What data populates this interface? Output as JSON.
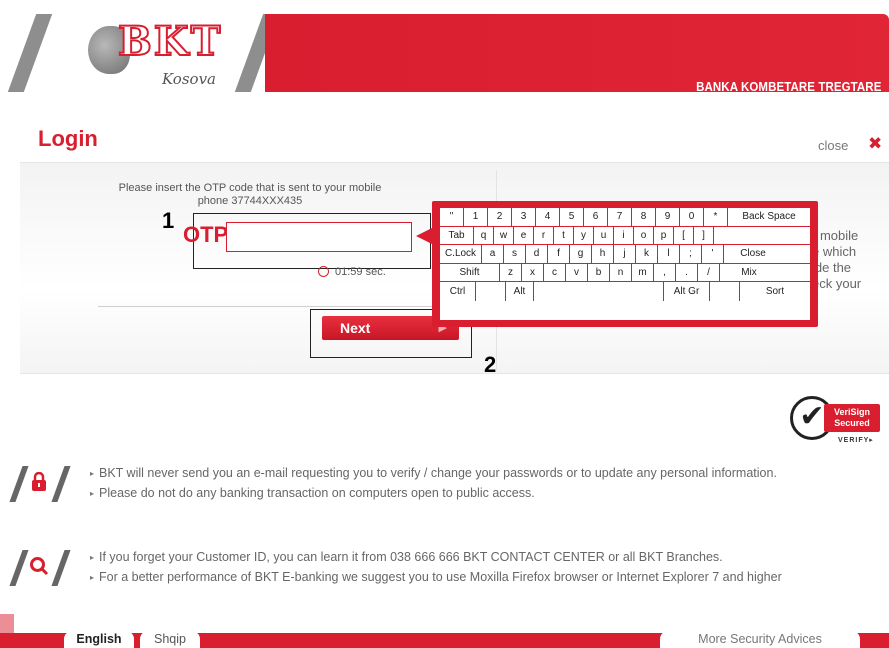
{
  "header": {
    "logo_text": "BKT",
    "logo_subtitle": "Kosova",
    "bank_name": "BANKA KOMBETARE TREGTARE"
  },
  "login": {
    "title": "Login",
    "close_label": "close",
    "close_icon": "✖",
    "instruction_line1": "Please insert the OTP code that is sent to your mobile",
    "instruction_line2": "phone 37744XXX435",
    "otp_label": "OTP",
    "otp_value": "",
    "timer_text": "01:59 sec.",
    "next_label": "Next",
    "next_arrow": "▶",
    "annotation_1": "1",
    "annotation_2": "2",
    "side_text": [
      "r mobile",
      "e which",
      "ide the",
      "eck your"
    ]
  },
  "keyboard": {
    "rows": [
      [
        "\"",
        "1",
        "2",
        "3",
        "4",
        "5",
        "6",
        "7",
        "8",
        "9",
        "0",
        "*",
        "Back Space"
      ],
      [
        "Tab",
        "q",
        "w",
        "e",
        "r",
        "t",
        "y",
        "u",
        "i",
        "o",
        "p",
        "[",
        "]",
        ""
      ],
      [
        "C.Lock",
        "a",
        "s",
        "d",
        "f",
        "g",
        "h",
        "j",
        "k",
        "l",
        ";",
        "'",
        "Close"
      ],
      [
        "Shift",
        "z",
        "x",
        "c",
        "v",
        "b",
        "n",
        "m",
        ",",
        ".",
        "/",
        "Mix"
      ],
      [
        "Ctrl",
        "",
        "Alt",
        "",
        "Alt Gr",
        "",
        "Sort"
      ]
    ]
  },
  "verisign": {
    "check": "✔",
    "line1": "VeriSign",
    "line2": "Secured",
    "verify": "VERIFY▸"
  },
  "notices": [
    {
      "icon": "lock-icon",
      "glyph": "🔒",
      "items": [
        "BKT will never send you an e-mail requesting you to verify / change your passwords or to update any personal information.",
        "Please do not do any banking transaction on computers open to public access."
      ]
    },
    {
      "icon": "search-icon",
      "glyph": "Q",
      "items": [
        "If you forget your Customer ID, you can learn it from 038 666 666 BKT CONTACT CENTER or all BKT Branches.",
        "For a better performance of BKT E-banking we suggest you to use Moxilla Firefox browser or Internet Explorer 7 and higher"
      ]
    }
  ],
  "footer": {
    "lang_english": "English",
    "lang_shqip": "Shqip",
    "more_security": "More Security Advices"
  },
  "colors": {
    "brand_red": "#d81e2f",
    "text_gray": "#666666"
  }
}
